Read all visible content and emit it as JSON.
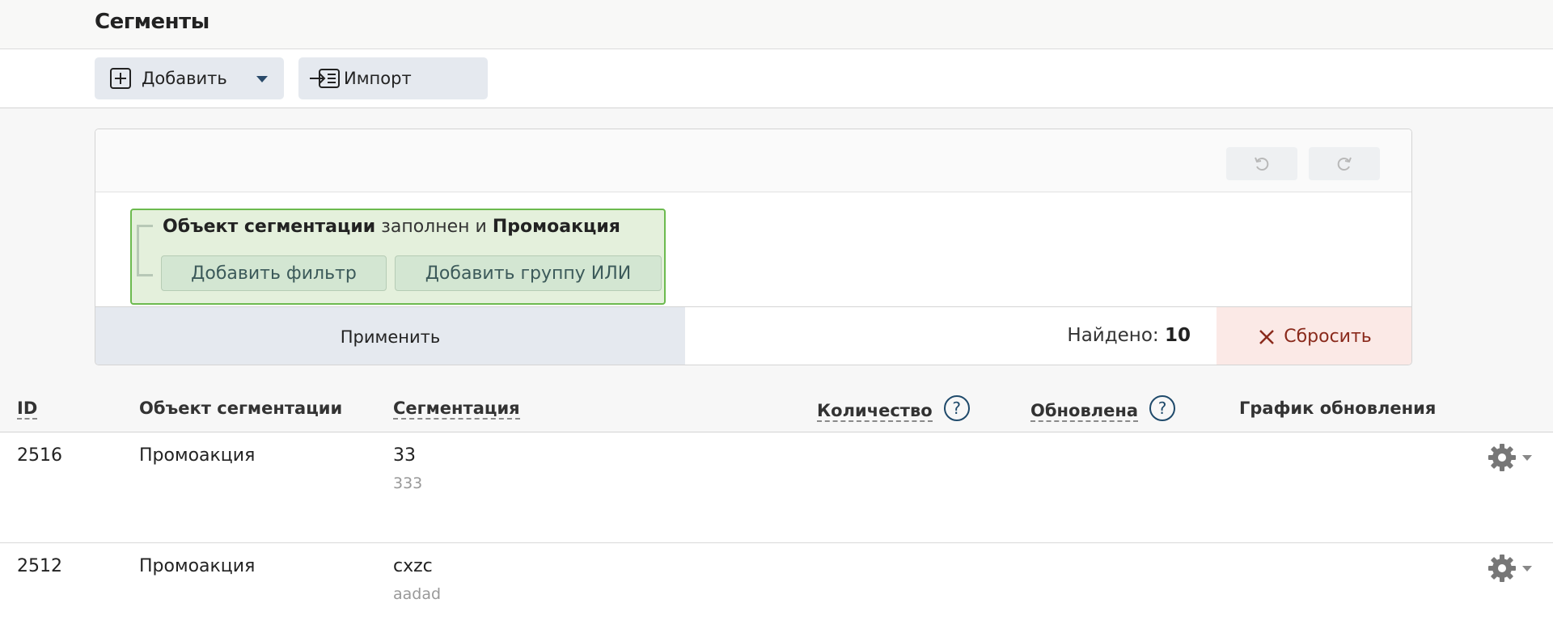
{
  "header": {
    "title": "Сегменты"
  },
  "toolbar": {
    "add_label": "Добавить",
    "import_label": "Импорт"
  },
  "filter": {
    "group": {
      "field_1": "Объект сегментации",
      "condition": "заполнен",
      "connector": "и",
      "field_2": "Промоакция",
      "add_filter_label": "Добавить фильтр",
      "add_or_group_label": "Добавить группу ИЛИ"
    },
    "apply_label": "Применить",
    "found_label": "Найдено:",
    "found_count": "10",
    "reset_label": "Сбросить"
  },
  "table": {
    "columns": {
      "id": "ID",
      "object": "Объект сегментации",
      "segmentation": "Сегментация",
      "count": "Количество",
      "updated": "Обновлена",
      "schedule": "График обновления"
    },
    "rows": [
      {
        "id": "2516",
        "object": "Промоакция",
        "name": "33",
        "description": "333"
      },
      {
        "id": "2512",
        "object": "Промоакция",
        "name": "cxzc",
        "description": "aadad"
      }
    ]
  },
  "icons": {
    "add": "plus-square-icon",
    "dropdown": "caret-down-icon",
    "import": "import-icon",
    "undo": "undo-icon",
    "redo": "redo-icon",
    "reset": "close-icon",
    "help": "help-circle-icon",
    "settings": "gear-icon"
  },
  "colors": {
    "accent_bg": "#e5e9ef",
    "group_bg": "#e4f0dc",
    "group_border": "#6cba4f",
    "reset_bg": "#fbe9e6",
    "reset_text": "#8a2a1c",
    "help_icon": "#1f4a6b"
  }
}
